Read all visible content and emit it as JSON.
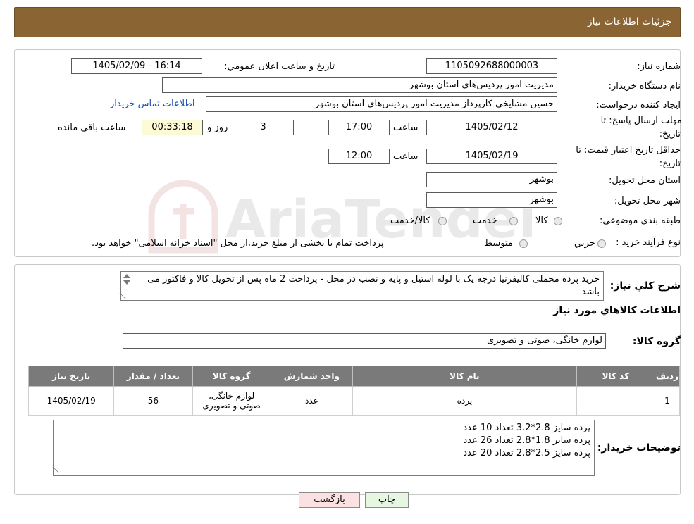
{
  "header": {
    "title": "جزئیات اطلاعات نیاز"
  },
  "form": {
    "need_number_label": "شماره نیاز:",
    "need_number": "1105092688000003",
    "announce_label": "تاریخ و ساعت اعلان عمومي:",
    "announce_value": "1405/02/09 - 16:14",
    "buyer_org_label": "نام دستگاه خريدار:",
    "buyer_org": "مدیریت امور پردیس‌های استان بوشهر",
    "creator_label": "ايجاد کننده درخواست:",
    "creator": "حسین مشایخی کارپرداز مدیریت امور پردیس‌های استان بوشهر",
    "contact_link": "اطلاعات تماس خريدار",
    "deadline_label_1": "مهلت ارسال پاسخ: تا",
    "deadline_label_2": "تاریخ:",
    "deadline_date": "1405/02/12",
    "time_label": "ساعت",
    "deadline_time": "17:00",
    "days_value": "3",
    "days_label": "روز و",
    "remaining_value": "00:33:18",
    "remaining_label": "ساعت باقي مانده",
    "validity_label_1": "حداقل تاريخ اعتبار قيمت: تا",
    "validity_label_2": "تاریخ:",
    "validity_date": "1405/02/19",
    "validity_time_label": "ساعت",
    "validity_time": "12:00",
    "province_label": "استان محل تحويل:",
    "province": "بوشهر",
    "city_label": "شهر محل تحويل:",
    "city": "بوشهر",
    "category_label": "طبقه بندی موضوعی:",
    "category_options": [
      "کالا",
      "خدمت",
      "کالا/خدمت"
    ],
    "process_label": "نوع فرآيند خريد :",
    "process_options": [
      "جزيي",
      "متوسط"
    ],
    "process_note": "پرداخت تمام یا بخشی از مبلغ خرید،از محل \"اسناد خزانه اسلامی\" خواهد بود."
  },
  "description": {
    "label": "شرح کلي نياز:",
    "text": "خرید پرده مخملی کالیفرنیا درجه یک با لوله استیل و پایه و نصب در محل - پرداخت 2 ماه پس از تحویل کالا و فاکتور می باشد",
    "items_title": "اطلاعات کالاهاي مورد نياز",
    "group_label": "گروه کالا:",
    "group_value": "لوازم خانگی، صوتی و تصویری"
  },
  "table": {
    "headers": [
      "رديف",
      "کد کالا",
      "نام کالا",
      "واحد شمارش",
      "گروه کالا",
      "تعداد / مقدار",
      "تاریخ نیاز"
    ],
    "rows": [
      [
        "1",
        "--",
        "پرده",
        "عدد",
        "لوازم خانگی، صوتی و تصویری",
        "56",
        "1405/02/19"
      ]
    ]
  },
  "buyer_notes": {
    "label": "توضيحات خريدار:",
    "lines": [
      "پرده سایز 2.8*3.2 تعداد 10 عدد",
      "پرده سایز 1.8*2.8 تعداد 26 عدد",
      "پرده سایز 2.5*2.8 تعداد 20 عدد"
    ]
  },
  "buttons": {
    "print": "چاپ",
    "back": "بازگشت"
  },
  "watermark": {
    "text": "AriaTender.neT"
  },
  "colors": {
    "header_bg": "#8b6434",
    "remaining_bg": "#fdfbd6",
    "print_bg": "#e5f7e0",
    "back_bg": "#fbe1e1",
    "table_header": "#7a7a7a",
    "link": "#1a50b0"
  }
}
